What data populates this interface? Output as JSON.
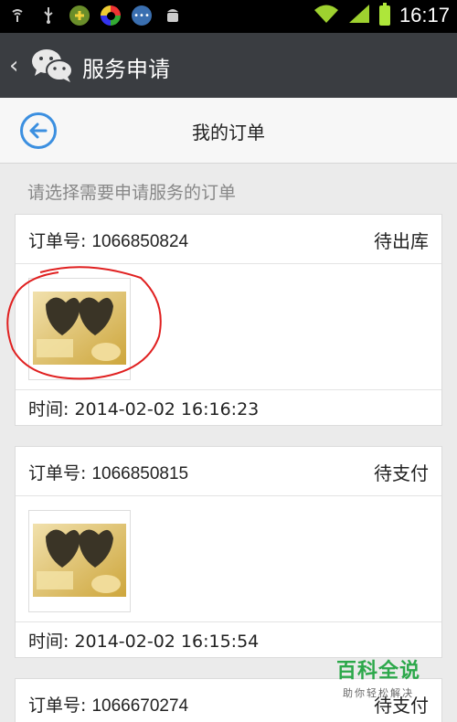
{
  "status_bar": {
    "time": "16:17",
    "icons": [
      "wifi-signal-icon",
      "usb-icon",
      "app-green-icon",
      "app-colorful-icon",
      "chat-bubble-icon",
      "android-icon",
      "wifi-icon",
      "signal-icon",
      "battery-icon"
    ]
  },
  "header": {
    "app_title": "服务申请"
  },
  "sub_header": {
    "title": "我的订单"
  },
  "prompt": "请选择需要申请服务的订单",
  "orders": [
    {
      "label": "订单号:",
      "number": "1066850824",
      "status": "待出库",
      "time_label": "时间:",
      "time": "2014-02-02 16:16:23"
    },
    {
      "label": "订单号:",
      "number": "1066850815",
      "status": "待支付",
      "time_label": "时间:",
      "time": "2014-02-02 16:15:54"
    },
    {
      "label": "订单号:",
      "number": "1066670274",
      "status": "待支付"
    }
  ],
  "watermark": {
    "main": "百科全说",
    "sub": "助你轻松解决"
  },
  "colors": {
    "title_bar": "#3a3d41",
    "accent_blue": "#3b8fe0",
    "annotation_red": "#e02020",
    "watermark_green": "#2ca84a"
  }
}
